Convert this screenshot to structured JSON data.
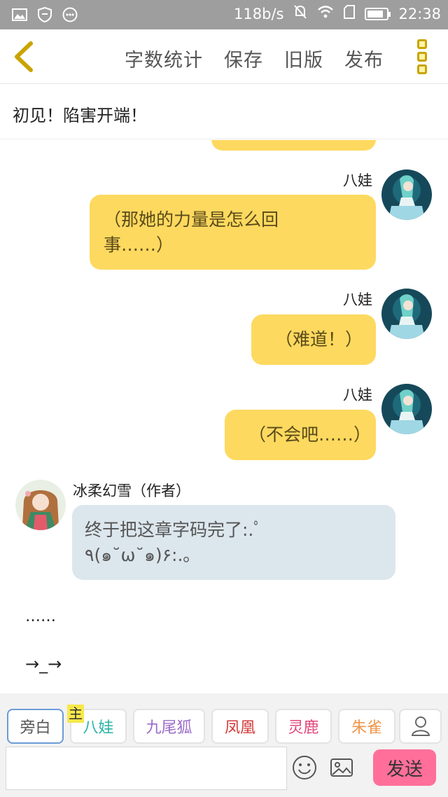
{
  "status_bar": {
    "speed": "118b/s",
    "time": "22:38",
    "battery_level": 0.85,
    "icons": [
      "image-icon",
      "shield-icon",
      "more-icon",
      "mute-icon",
      "wifi-icon",
      "sim-icon",
      "battery-icon"
    ]
  },
  "header": {
    "back_icon": "chevron-left-icon",
    "menu": [
      "字数统计",
      "保存",
      "旧版",
      "发布"
    ],
    "more_icon": "vertical-dots-icon",
    "accent": "#c9a400"
  },
  "chapter": {
    "title": "初见！陷害开端！"
  },
  "messages": [
    {
      "speaker": "八娃",
      "text_lines": [
        "（那她的力量是怎么回",
        "事……）"
      ]
    },
    {
      "speaker": "八娃",
      "text_lines": [
        "（难道！）"
      ]
    },
    {
      "speaker": "八娃",
      "text_lines": [
        "（不会吧……）"
      ]
    },
    {
      "speaker": "冰柔幻雪（作者）",
      "text_lines": [
        "终于把这章字码完了:.ﾟ",
        "٩(๑˘ω˘๑)۶:.｡"
      ]
    }
  ],
  "narration": [
    "……",
    "→_→"
  ],
  "roles": {
    "host_tag": "主",
    "items": [
      {
        "label": "旁白",
        "color": "#555555",
        "selected": true
      },
      {
        "label": "八娃",
        "color": "#2bb5a5",
        "selected": false
      },
      {
        "label": "九尾狐",
        "color": "#9a6cc9",
        "selected": false
      },
      {
        "label": "凤凰",
        "color": "#d33a3a",
        "selected": false
      },
      {
        "label": "灵鹿",
        "color": "#e0487a",
        "selected": false
      },
      {
        "label": "朱雀",
        "color": "#f0954a",
        "selected": false
      }
    ],
    "add_icon": "person-icon"
  },
  "composer": {
    "placeholder": "",
    "emoji_icon": "smiley-icon",
    "image_icon": "picture-icon",
    "send_label": "发送",
    "send_color": "#ff6f9a"
  },
  "colors": {
    "bubble_yellow": "#fdd95f",
    "bubble_blue": "#dce6ed"
  }
}
